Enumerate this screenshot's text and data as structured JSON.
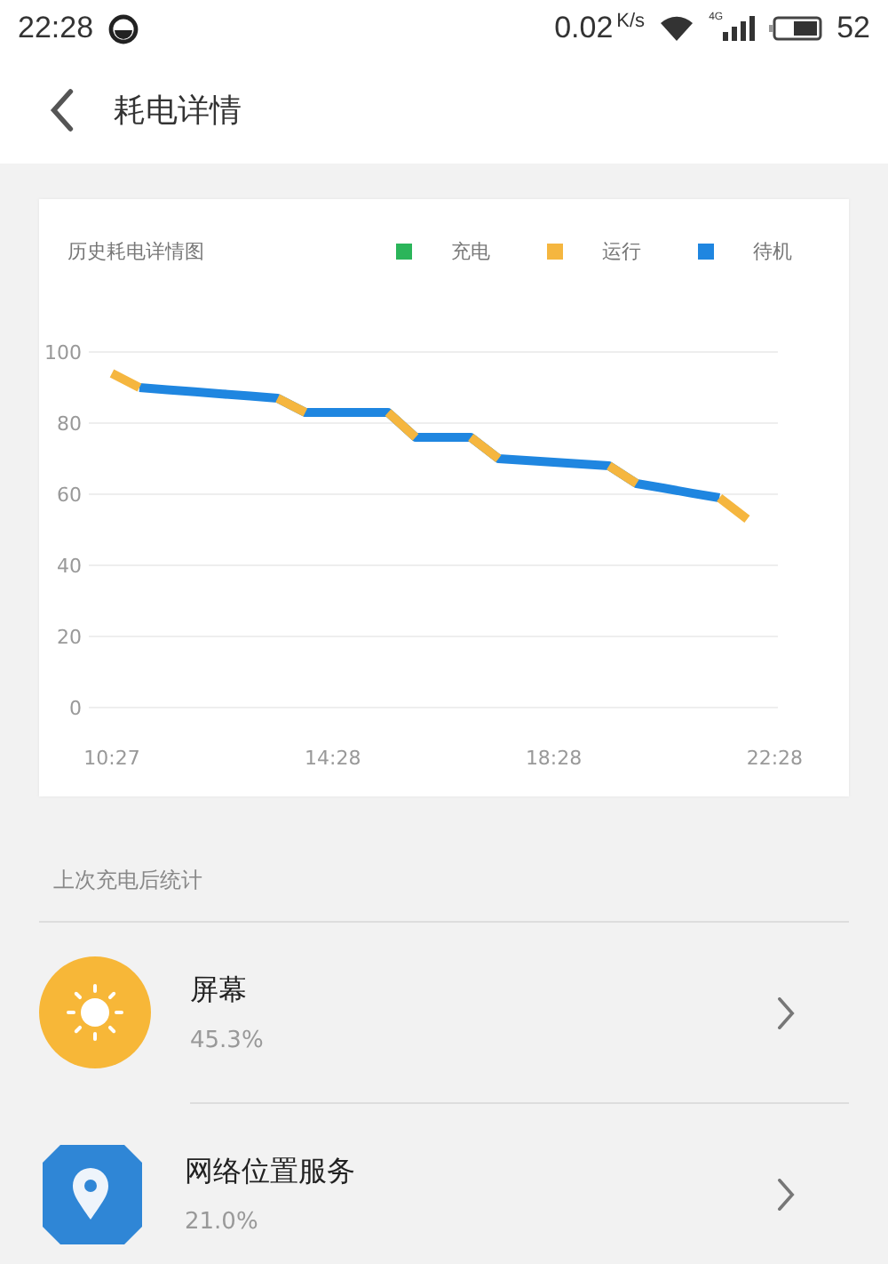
{
  "status_bar": {
    "time": "22:28",
    "speed": "0.02",
    "speed_unit": "K/s",
    "network": "4G",
    "battery": "52"
  },
  "header": {
    "title": "耗电详情"
  },
  "chart_card": {
    "title": "历史耗电详情图",
    "chart_data": {
      "type": "line",
      "categories": [
        "10:27",
        null,
        null,
        null,
        null,
        null,
        null,
        null,
        "14:28",
        null,
        null,
        null,
        null,
        null,
        null,
        null,
        "18:28",
        null,
        null,
        null,
        null,
        null,
        null,
        null,
        "22:28"
      ],
      "ylim": [
        0,
        100
      ],
      "grid": true,
      "yticks": [
        0,
        20,
        40,
        60,
        80,
        100
      ],
      "series": [
        {
          "name": "充电",
          "color": "#2bb55a",
          "values": [
            null,
            null,
            null,
            null,
            null,
            null,
            null,
            null,
            null,
            null,
            null,
            null,
            null,
            null,
            null,
            null,
            null,
            null,
            null,
            null,
            null,
            null,
            null,
            null,
            null
          ]
        },
        {
          "name": "运行",
          "color": "#f5b63f",
          "values": [
            94,
            90,
            null,
            null,
            null,
            null,
            87,
            83,
            null,
            null,
            83,
            76,
            null,
            76,
            70,
            null,
            null,
            null,
            68,
            63,
            null,
            null,
            59,
            53,
            null
          ]
        },
        {
          "name": "待机",
          "color": "#1f86e0",
          "values": [
            null,
            90,
            89.4,
            88.8,
            88.2,
            87.6,
            87,
            83,
            83,
            83,
            83,
            76,
            76,
            76,
            70,
            69.5,
            69,
            68.5,
            68,
            63,
            61.7,
            60.3,
            59,
            null,
            null
          ]
        }
      ]
    }
  },
  "section": {
    "title": "上次充电后统计"
  },
  "items": [
    {
      "kind": "screen",
      "name": "屏幕",
      "percent": "45.3%"
    },
    {
      "kind": "location",
      "name": "网络位置服务",
      "percent": "21.0%"
    }
  ]
}
